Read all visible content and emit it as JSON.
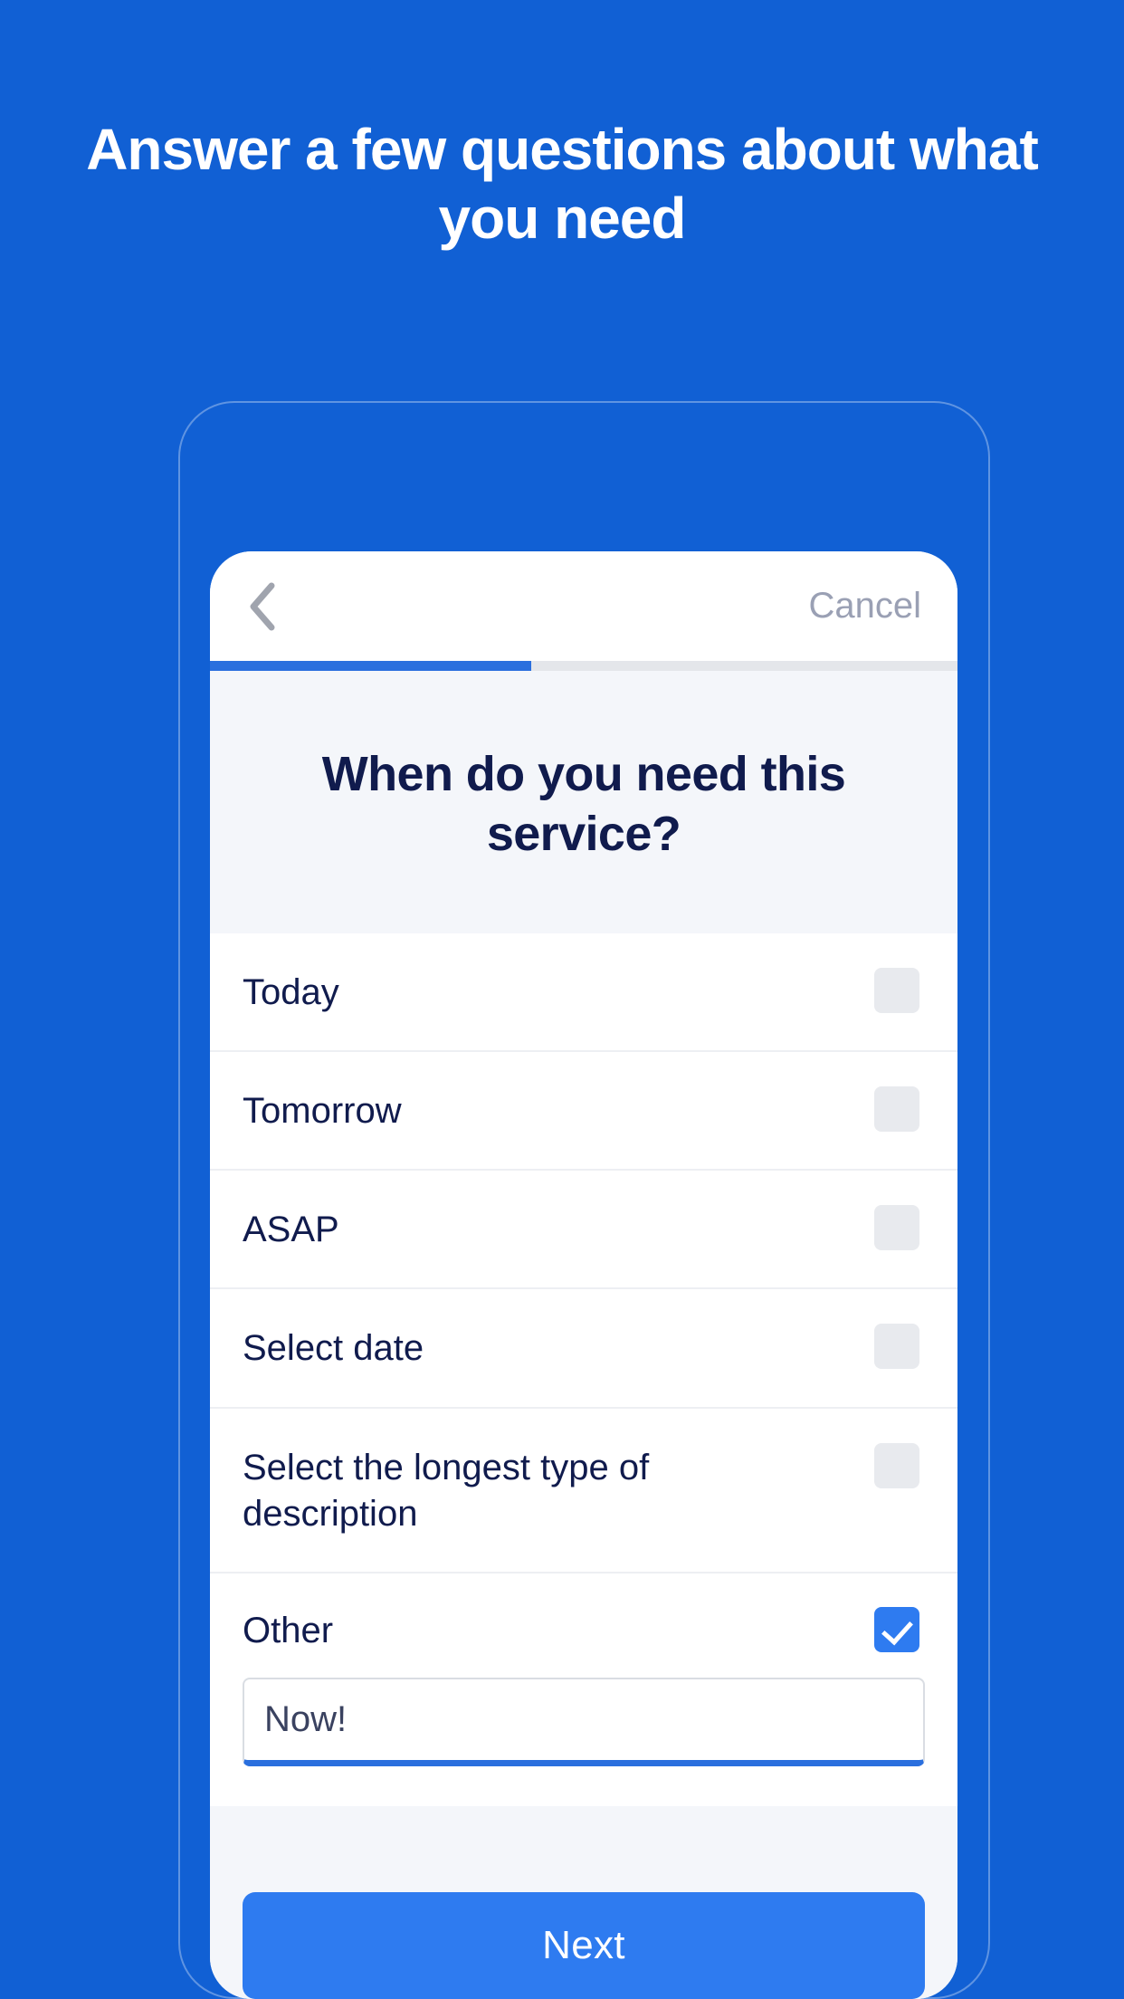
{
  "promo": {
    "title": "Answer a few questions about what you need",
    "background_color": "#1160D4"
  },
  "app": {
    "navbar": {
      "back_icon": "chevron-left-icon",
      "cancel_label": "Cancel"
    },
    "progress": {
      "percent": 43,
      "fill_color": "#2A6FDE",
      "track_color": "#E4E6EA"
    },
    "question": "When do you need this service?",
    "options": [
      {
        "label": "Today",
        "checked": false
      },
      {
        "label": "Tomorrow",
        "checked": false
      },
      {
        "label": "ASAP",
        "checked": false
      },
      {
        "label": "Select date",
        "checked": false
      },
      {
        "label": "Select the longest type of description",
        "checked": false
      },
      {
        "label": "Other",
        "checked": true
      }
    ],
    "other_input": {
      "value": "Now!",
      "placeholder": "Now!"
    },
    "footer": {
      "next_label": "Next",
      "next_color": "#2E7BF0"
    }
  }
}
